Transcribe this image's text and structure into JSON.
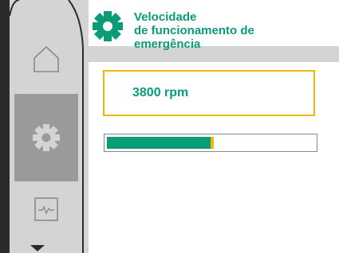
{
  "header": {
    "icon": "gear-icon",
    "title_lines": [
      "Velocidade",
      "de funcionamento de",
      "emergência"
    ]
  },
  "nav": {
    "items": [
      {
        "icon": "home-icon",
        "active": false
      },
      {
        "icon": "gear-icon",
        "active": true
      },
      {
        "icon": "diagnostics-icon",
        "active": false
      }
    ],
    "scroll_icon": "chevron-down-icon"
  },
  "value": {
    "display": "3800 rpm",
    "fill_fraction": 0.5
  },
  "colors": {
    "accent": "#0a9b78",
    "highlight": "#f2b705",
    "sidebar": "#d4d4d4",
    "sidebar_active": "#9a9a9a"
  }
}
